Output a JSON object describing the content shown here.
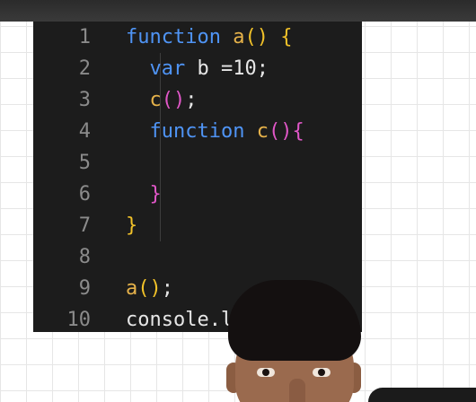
{
  "editor": {
    "lines": [
      {
        "num": "1",
        "tokens": [
          {
            "t": "function",
            "c": "keyword"
          },
          {
            "t": " ",
            "c": "plain"
          },
          {
            "t": "a",
            "c": "fn"
          },
          {
            "t": "()",
            "c": "paren-yellow"
          },
          {
            "t": " ",
            "c": "plain"
          },
          {
            "t": "{",
            "c": "paren-yellow"
          }
        ]
      },
      {
        "num": "2",
        "tokens": [
          {
            "t": "  ",
            "c": "plain"
          },
          {
            "t": "var",
            "c": "keyword"
          },
          {
            "t": " b =10;",
            "c": "plain"
          }
        ]
      },
      {
        "num": "3",
        "tokens": [
          {
            "t": "  ",
            "c": "plain"
          },
          {
            "t": "c",
            "c": "fn"
          },
          {
            "t": "()",
            "c": "paren-pink"
          },
          {
            "t": ";",
            "c": "plain"
          }
        ]
      },
      {
        "num": "4",
        "tokens": [
          {
            "t": "  ",
            "c": "plain"
          },
          {
            "t": "function",
            "c": "keyword"
          },
          {
            "t": " ",
            "c": "plain"
          },
          {
            "t": "c",
            "c": "fn"
          },
          {
            "t": "()",
            "c": "paren-pink"
          },
          {
            "t": "{",
            "c": "paren-pink"
          }
        ]
      },
      {
        "num": "5",
        "tokens": []
      },
      {
        "num": "6",
        "tokens": [
          {
            "t": "  ",
            "c": "plain"
          },
          {
            "t": "}",
            "c": "paren-pink"
          }
        ]
      },
      {
        "num": "7",
        "tokens": [
          {
            "t": "}",
            "c": "paren-yellow"
          }
        ]
      },
      {
        "num": "8",
        "tokens": []
      },
      {
        "num": "9",
        "tokens": [
          {
            "t": "a",
            "c": "fn"
          },
          {
            "t": "()",
            "c": "paren-yellow"
          },
          {
            "t": ";",
            "c": "plain"
          }
        ]
      },
      {
        "num": "10",
        "tokens": [
          {
            "t": "console.l",
            "c": "plain"
          }
        ]
      }
    ]
  },
  "colors": {
    "keyword": "#4f94f5",
    "function_name": "#e6b24a",
    "bracket_level1": "#f2c229",
    "bracket_level2": "#e157c8",
    "editor_background": "#1c1c1c",
    "line_number": "#8b8b8b"
  }
}
